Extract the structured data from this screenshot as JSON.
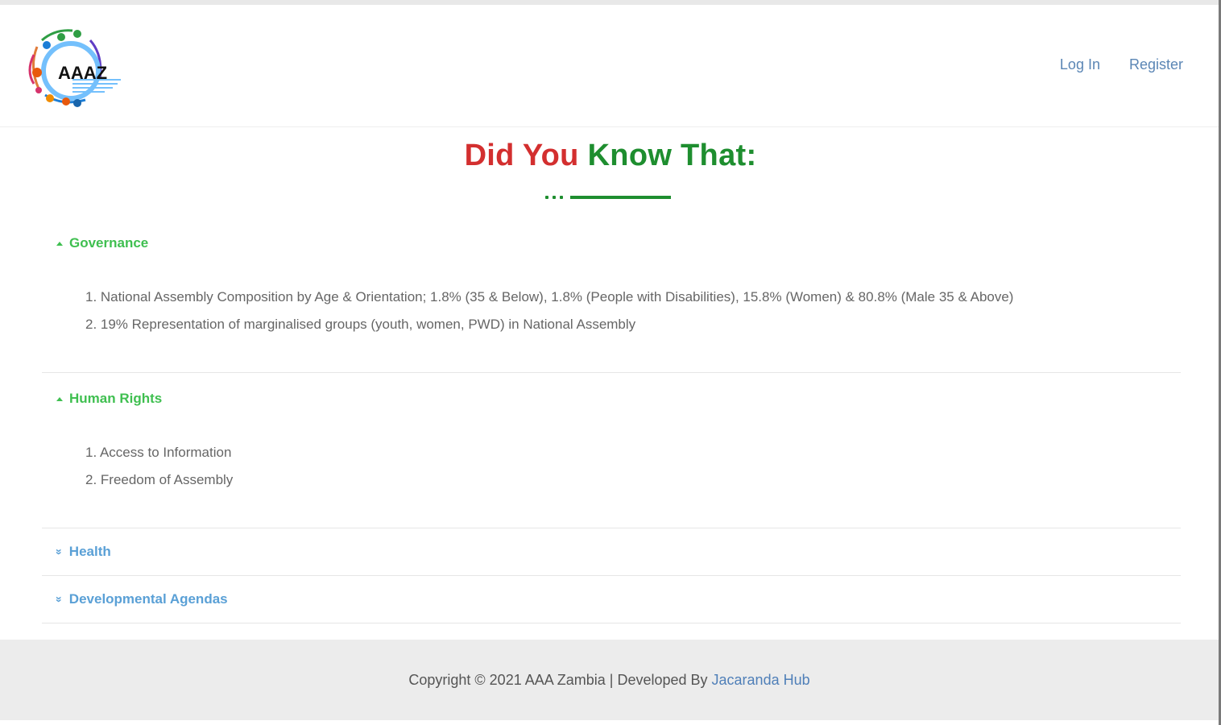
{
  "header": {
    "logo_text": "AAAZ",
    "nav": {
      "login": "Log In",
      "register": "Register"
    }
  },
  "title": {
    "part1": "Did You",
    "part2": "Know That:"
  },
  "sections": [
    {
      "label": "Governance",
      "state": "expanded",
      "items": [
        "1. National Assembly Composition by Age & Orientation; 1.8% (35 & Below), 1.8% (People with Disabilities), 15.8% (Women) & 80.8% (Male 35 & Above)",
        "2. 19% Representation of marginalised groups (youth, women, PWD) in National Assembly"
      ]
    },
    {
      "label": "Human Rights",
      "state": "expanded",
      "items": [
        "1. Access to Information",
        "2. Freedom of Assembly"
      ]
    },
    {
      "label": "Health",
      "state": "collapsed"
    },
    {
      "label": "Developmental Agendas",
      "state": "collapsed"
    }
  ],
  "footer": {
    "copyright": "Copyright © 2021 AAA Zambia | Developed By",
    "link": "Jacaranda Hub"
  },
  "colors": {
    "title_red": "#d32f2f",
    "title_green": "#1e8e2f",
    "open_section": "#3fbf50",
    "closed_section": "#5aa0d6",
    "nav_link": "#5b86b5",
    "footer_bg": "#ececec"
  },
  "icons": {
    "open_section": "caret-up-icon",
    "closed_section": "double-chevron-down-icon"
  }
}
